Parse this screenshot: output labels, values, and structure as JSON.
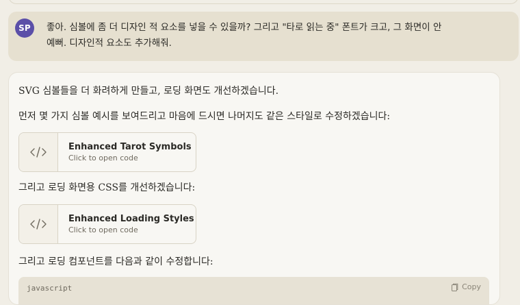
{
  "user_message": {
    "avatar_initials": "SP",
    "line1": "좋아. 심볼에 좀 더 디자인 적 요소를 넣을 수 있을까? 그리고 \"타로 읽는 중\" 폰트가 크고, 그 화면이 안",
    "line2": "예뻐. 디자인적 요소도 추가해줘."
  },
  "assistant": {
    "para1": "SVG 심볼들을 더 화려하게 만들고, 로딩 화면도 개선하겠습니다.",
    "para2": "먼저 몇 가지 심볼 예시를 보여드리고 마음에 드시면 나머지도 같은 스타일로 수정하겠습니다:",
    "artifact1": {
      "title": "Enhanced Tarot Symbols",
      "subtitle": "Click to open code"
    },
    "para3": "그리고 로딩 화면용 CSS를 개선하겠습니다:",
    "artifact2": {
      "title": "Enhanced Loading Styles",
      "subtitle": "Click to open code"
    },
    "para4": "그리고 로딩 컴포넌트를 다음과 같이 수정합니다:",
    "code_block": {
      "language": "javascript",
      "copy_label": "Copy"
    }
  },
  "colors": {
    "background": "#f1eee6",
    "user_bubble": "#e6e0d0",
    "avatar": "#5b4fa8",
    "card": "#f8f7f3",
    "code_header": "#e7e2d5"
  },
  "icons": {
    "artifact": "code-brackets-icon",
    "copy": "copy-icon"
  }
}
